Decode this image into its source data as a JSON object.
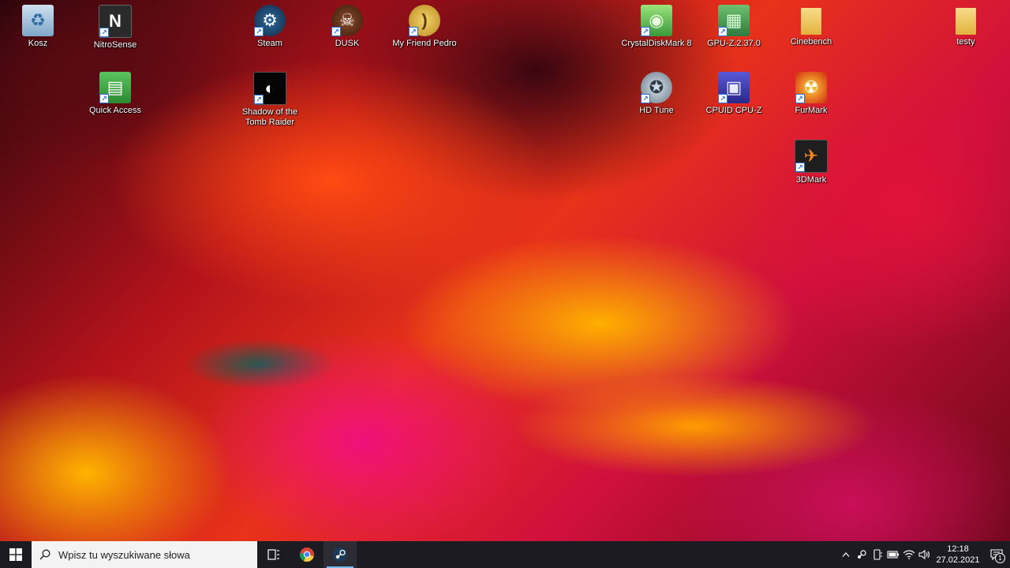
{
  "desktop": {
    "icons": [
      {
        "label": "Kosz",
        "glyph": "♻",
        "color": "#7fa7c9",
        "shortcut": false
      },
      {
        "label": "NitroSense",
        "glyph": "N",
        "color": "#2a2a2a",
        "shortcut": true
      },
      {
        "label": "Steam",
        "glyph": "⚙",
        "color": "#1b3a5c",
        "shortcut": true
      },
      {
        "label": "DUSK",
        "glyph": "☠",
        "color": "#6b3a22",
        "shortcut": true
      },
      {
        "label": "My Friend Pedro",
        "glyph": "🍌",
        "color": "#d8b040",
        "shortcut": true
      },
      {
        "label": "CrystalDiskMark 8",
        "glyph": "◉",
        "color": "#4caf50",
        "shortcut": true
      },
      {
        "label": "GPU-Z.2.37.0",
        "glyph": "▦",
        "color": "#3e8e4e",
        "shortcut": true
      },
      {
        "label": "Cinebench",
        "glyph": "",
        "color": "#e9c15a",
        "shortcut": false
      },
      {
        "label": "testy",
        "glyph": "",
        "color": "#e9c15a",
        "shortcut": false
      },
      {
        "label": "Quick Access",
        "glyph": "▤",
        "color": "#3aa640",
        "shortcut": true
      },
      {
        "label": "Shadow of the Tomb Raider",
        "glyph": "◐",
        "color": "#0a0a0a",
        "shortcut": true
      },
      {
        "label": "HD Tune",
        "glyph": "✪",
        "color": "#8a9aa8",
        "shortcut": true
      },
      {
        "label": "CPUID CPU-Z",
        "glyph": "▣",
        "color": "#3c3aa8",
        "shortcut": true
      },
      {
        "label": "FurMark",
        "glyph": "☢",
        "color": "#d02a10",
        "shortcut": true
      },
      {
        "label": "3DMark",
        "glyph": "✈",
        "color": "#222222",
        "shortcut": true
      }
    ]
  },
  "taskbar": {
    "search_placeholder": "Wpisz tu wyszukiwane słowa",
    "clock_time": "12:18",
    "clock_date": "27.02.2021",
    "notification_count": "1"
  }
}
